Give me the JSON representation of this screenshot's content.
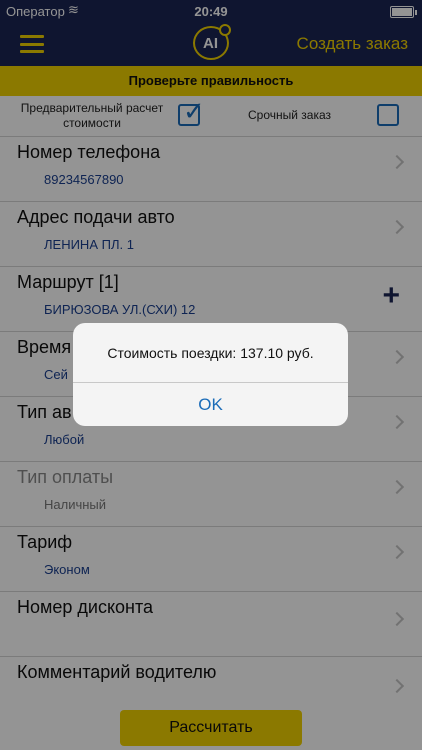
{
  "status": {
    "carrier": "Оператор",
    "time": "20:49"
  },
  "nav": {
    "title": "Создать заказ",
    "logo_text": "AI"
  },
  "banner": "Проверьте правильность",
  "options": {
    "preliminary_label": "Предварительный расчет стоимости",
    "preliminary_checked": true,
    "urgent_label": "Срочный заказ",
    "urgent_checked": false
  },
  "rows": [
    {
      "title": "Номер телефона",
      "value": "89234567890"
    },
    {
      "title": "Адрес подачи авто",
      "value": "ЛЕНИНА ПЛ. 1"
    },
    {
      "title": "Маршрут [1]",
      "value": "БИРЮЗОВА УЛ.(СХИ) 12"
    },
    {
      "title": "Время",
      "value": "Сей"
    },
    {
      "title": "Тип ав",
      "value": "Любой"
    },
    {
      "title": "Тип оплаты",
      "value": "Наличный"
    },
    {
      "title": "Тариф",
      "value": "Эконом"
    },
    {
      "title": "Номер дисконта",
      "value": ""
    },
    {
      "title": "Комментарий водителю",
      "value": ""
    }
  ],
  "calc_button": "Рассчитать",
  "alert": {
    "message": "Стоимость поездки: 137.10 руб.",
    "ok": "OK"
  },
  "colors": {
    "navy": "#1b2553",
    "yellow": "#f0d000",
    "link_blue": "#1b6cb8"
  }
}
